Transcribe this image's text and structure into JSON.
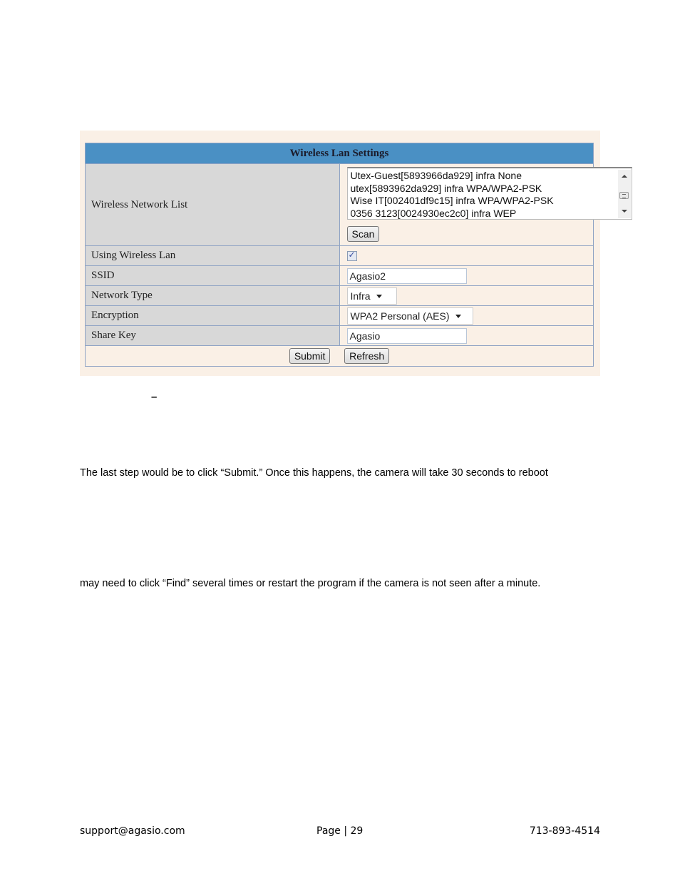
{
  "settings_panel": {
    "title": "Wireless Lan Settings",
    "colors": {
      "header_bg": "#4a90c4",
      "label_bg": "#d8d8d8",
      "value_bg": "#faf0e6",
      "border": "#8fa3c4"
    },
    "rows": {
      "network_list": {
        "label": "Wireless Network List",
        "items": [
          "Utex-Guest[5893966da929] infra None",
          "utex[5893962da929] infra WPA/WPA2-PSK",
          "Wise IT[002401df9c15] infra WPA/WPA2-PSK",
          "0356 3123[0024930ec2c0] infra WEP"
        ],
        "scan_button": "Scan"
      },
      "using_wireless_lan": {
        "label": "Using Wireless Lan",
        "checked": true
      },
      "ssid": {
        "label": "SSID",
        "value": "Agasio2"
      },
      "network_type": {
        "label": "Network Type",
        "selected": "Infra"
      },
      "encryption": {
        "label": "Encryption",
        "selected": "WPA2 Personal (AES)"
      },
      "share_key": {
        "label": "Share Key",
        "value": "Agasio"
      }
    },
    "buttons": {
      "submit": "Submit",
      "refresh": "Refresh"
    }
  },
  "document": {
    "dash": "–",
    "paragraph_1": "The last step would be to click “Submit.” Once this happens, the camera will take 30 seconds to reboot",
    "paragraph_2": "may need to click “Find” several times or restart the program if the camera is not seen after a minute."
  },
  "footer": {
    "email": "support@agasio.com",
    "page": "Page | 29",
    "phone": "713-893-4514"
  }
}
